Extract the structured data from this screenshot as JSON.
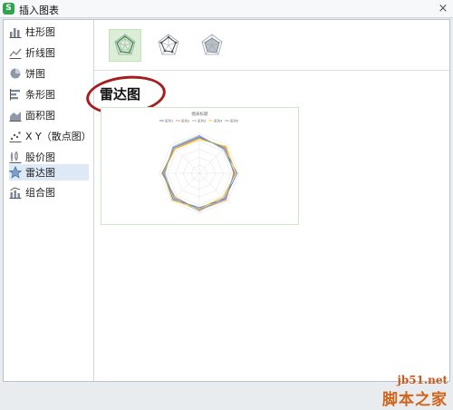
{
  "window": {
    "title": "插入图表"
  },
  "sidebar": {
    "items": [
      {
        "label": "柱形图",
        "icon": "bar-chart-icon"
      },
      {
        "label": "折线图",
        "icon": "line-chart-icon"
      },
      {
        "label": "饼图",
        "icon": "pie-chart-icon"
      },
      {
        "label": "条形图",
        "icon": "horizontal-bar-icon"
      },
      {
        "label": "面积图",
        "icon": "area-chart-icon"
      },
      {
        "label": "X Y（散点图）",
        "icon": "scatter-chart-icon"
      },
      {
        "label": "股价图",
        "icon": "stock-chart-icon"
      },
      {
        "label": "雷达图",
        "icon": "radar-chart-icon",
        "selected": true
      },
      {
        "label": "组合图",
        "icon": "combo-chart-icon"
      }
    ]
  },
  "subtypes": [
    {
      "name": "radar",
      "selected": true
    },
    {
      "name": "radar-with-markers"
    },
    {
      "name": "filled-radar"
    }
  ],
  "main": {
    "heading": "雷达图"
  },
  "preview": {
    "title": "图表标题",
    "legend": [
      "系列1",
      "系列2",
      "系列3",
      "系列4",
      "系列5"
    ],
    "series_colors": [
      "#4472c4",
      "#ed7d31",
      "#a5a5a5",
      "#ffc000",
      "#5b9bd5"
    ],
    "ring_count": 5,
    "axis_count": 8
  },
  "watermark": {
    "site": "jb51.net",
    "name": "脚本之家"
  },
  "colors": {
    "accent": "#2ea44f",
    "selection": "#dde9f7",
    "annotation": "#a51d1d"
  }
}
